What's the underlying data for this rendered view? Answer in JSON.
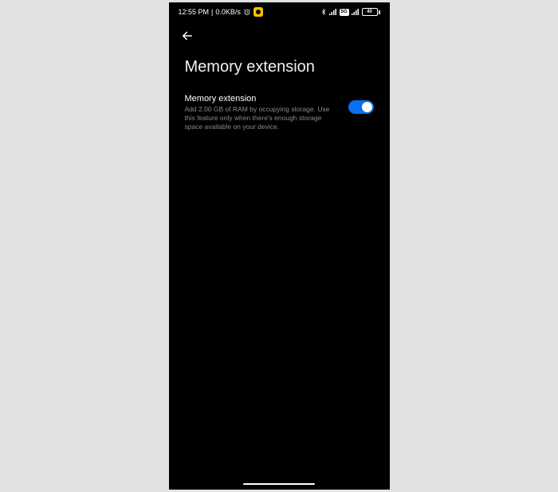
{
  "status_bar": {
    "time": "12:55 PM",
    "net_speed": "0.0KB/s",
    "battery_pct": "40"
  },
  "page": {
    "title": "Memory extension"
  },
  "setting": {
    "title": "Memory extension",
    "description": "Add 2.00 GB of RAM by occupying storage. Use this feature only when there's enough storage space available on your device.",
    "toggle_on": true
  }
}
